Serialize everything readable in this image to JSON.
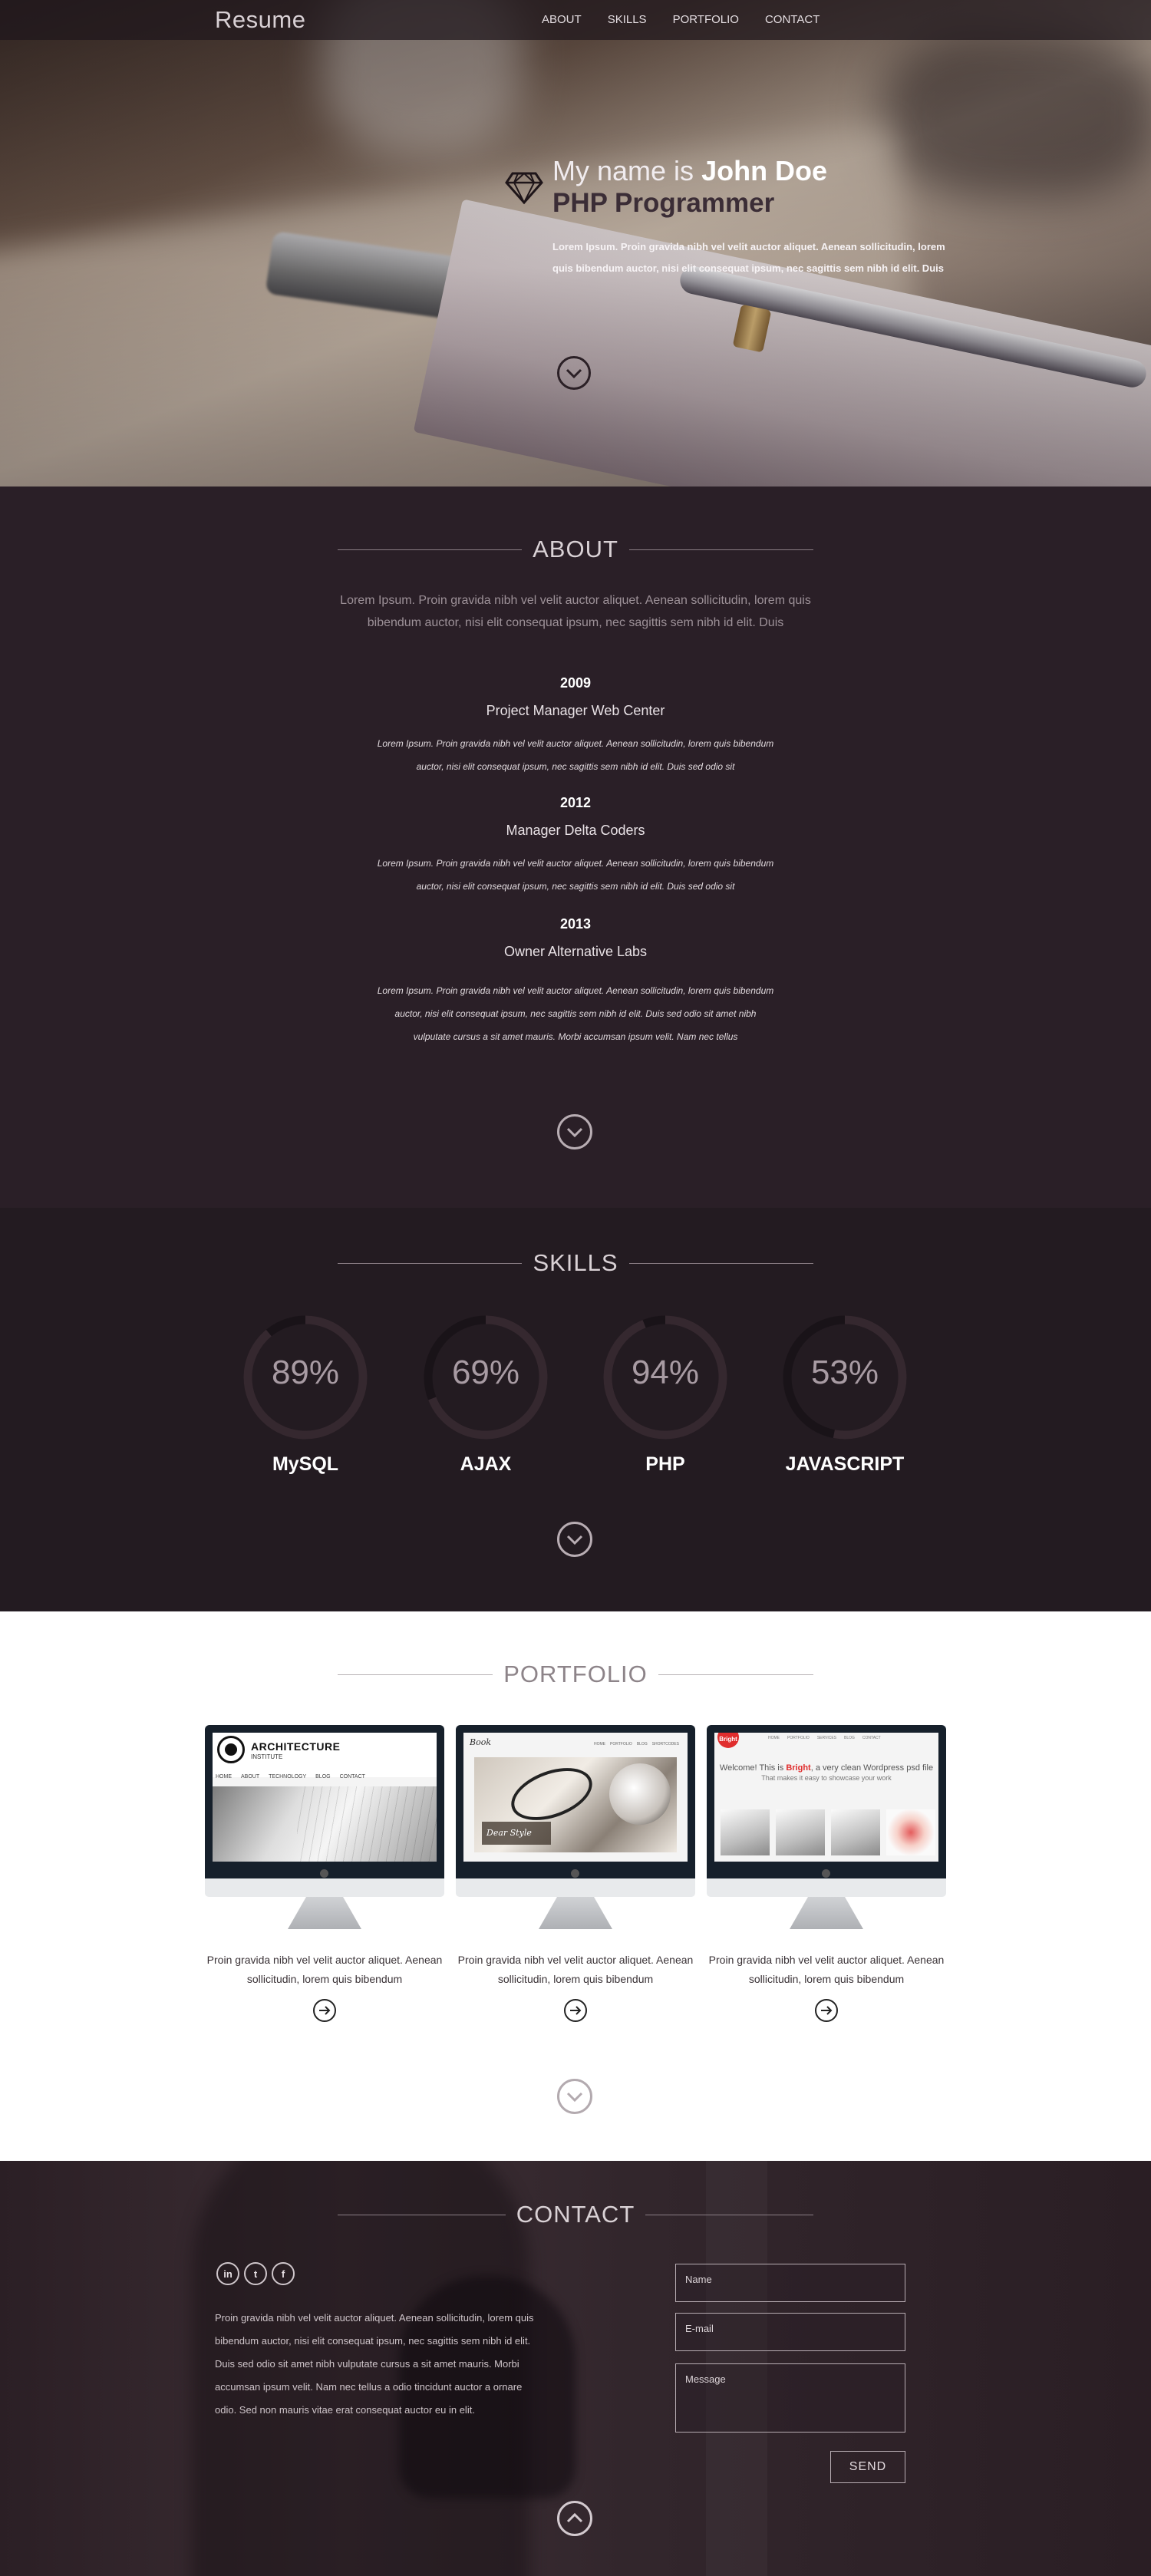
{
  "nav": {
    "brand": "Resume",
    "items": [
      "ABOUT",
      "SKILLS",
      "PORTFOLIO",
      "CONTACT"
    ]
  },
  "hero": {
    "greeting": "My name is",
    "name": "John Doe",
    "role": "PHP Programmer",
    "intro": "Lorem Ipsum. Proin gravida nibh vel velit auctor aliquet. Aenean sollicitudin, lorem quis bibendum auctor, nisi elit consequat ipsum, nec sagittis sem nibh id elit. Duis"
  },
  "about": {
    "title": "ABOUT",
    "lead": "Lorem Ipsum. Proin gravida nibh vel velit auctor aliquet. Aenean sollicitudin, lorem quis bibendum auctor, nisi elit consequat ipsum, nec sagittis sem nibh id elit. Duis",
    "timeline": [
      {
        "year": "2009",
        "role": "Project Manager Web Center",
        "desc": "Lorem Ipsum. Proin gravida nibh vel velit auctor aliquet. Aenean sollicitudin, lorem quis bibendum auctor, nisi elit consequat ipsum, nec sagittis sem nibh id elit. Duis sed odio sit"
      },
      {
        "year": "2012",
        "role": "Manager Delta Coders",
        "desc": "Lorem Ipsum. Proin gravida nibh vel velit auctor aliquet. Aenean sollicitudin, lorem quis bibendum auctor, nisi elit consequat ipsum, nec sagittis sem nibh id elit. Duis sed odio sit"
      },
      {
        "year": "2013",
        "role": "Owner Alternative Labs",
        "desc": "Lorem Ipsum. Proin gravida nibh vel velit auctor aliquet. Aenean sollicitudin, lorem quis bibendum auctor, nisi elit consequat ipsum, nec sagittis sem nibh id elit. Duis sed odio sit amet nibh vulputate cursus a sit amet mauris. Morbi accumsan ipsum velit. Nam nec tellus"
      }
    ]
  },
  "skills": {
    "title": "SKILLS",
    "items": [
      {
        "label": "MySQL",
        "value": 89,
        "text": "89%"
      },
      {
        "label": "AJAX",
        "value": 69,
        "text": "69%"
      },
      {
        "label": "PHP",
        "value": 94,
        "text": "94%"
      },
      {
        "label": "JAVASCRIPT",
        "value": 53,
        "text": "53%"
      }
    ],
    "colors": {
      "track": "#191318",
      "fill": "#35282f"
    }
  },
  "portfolio": {
    "title": "PORTFOLIO",
    "cards": [
      {
        "text": "Proin gravida nibh vel velit auctor aliquet. Aenean sollicitudin, lorem quis bibendum",
        "screen": {
          "title": "ARCHITECTURE",
          "subtitle": "INSTITUTE",
          "nav": [
            "HOME",
            "ABOUT",
            "TECHNOLOGY",
            "BLOG",
            "CONTACT"
          ]
        }
      },
      {
        "text": "Proin gravida nibh vel velit auctor aliquet. Aenean sollicitudin, lorem quis bibendum",
        "screen": {
          "brand": "Book",
          "tag": "Dear Style",
          "nav": [
            "HOME",
            "PORTFOLIO",
            "BLOG",
            "SHORTCODES"
          ]
        }
      },
      {
        "text": "Proin gravida nibh vel velit auctor aliquet. Aenean sollicitudin, lorem quis bibendum",
        "screen": {
          "badge": "Bright",
          "welcome_pre": "Welcome! This is",
          "welcome_brand": "Bright",
          "welcome_post": ", a very clean Wordpress psd file",
          "sub": "That makes it easy to showcase your work",
          "nav": [
            "HOME",
            "PORTFOLIO",
            "SERVICES",
            "BLOG",
            "CONTACT"
          ]
        }
      }
    ]
  },
  "contact": {
    "title": "CONTACT",
    "socials": [
      "in",
      "t",
      "f"
    ],
    "copy": "Proin gravida nibh vel velit auctor aliquet. Aenean sollicitudin, lorem quis bibendum auctor, nisi elit consequat ipsum, nec sagittis sem nibh id elit. Duis sed odio sit amet nibh vulputate cursus a sit amet mauris. Morbi accumsan ipsum velit. Nam nec tellus a odio tincidunt auctor a ornare odio. Sed non mauris vitae erat consequat auctor eu in elit.",
    "form": {
      "name": "Name",
      "email": "E-mail",
      "message": "Message",
      "send": "SEND"
    }
  },
  "icons": [
    "diamond-icon",
    "chevron-down-icon",
    "chevron-up-icon",
    "arrow-right-icon",
    "linkedin-icon",
    "twitter-icon",
    "facebook-icon"
  ]
}
